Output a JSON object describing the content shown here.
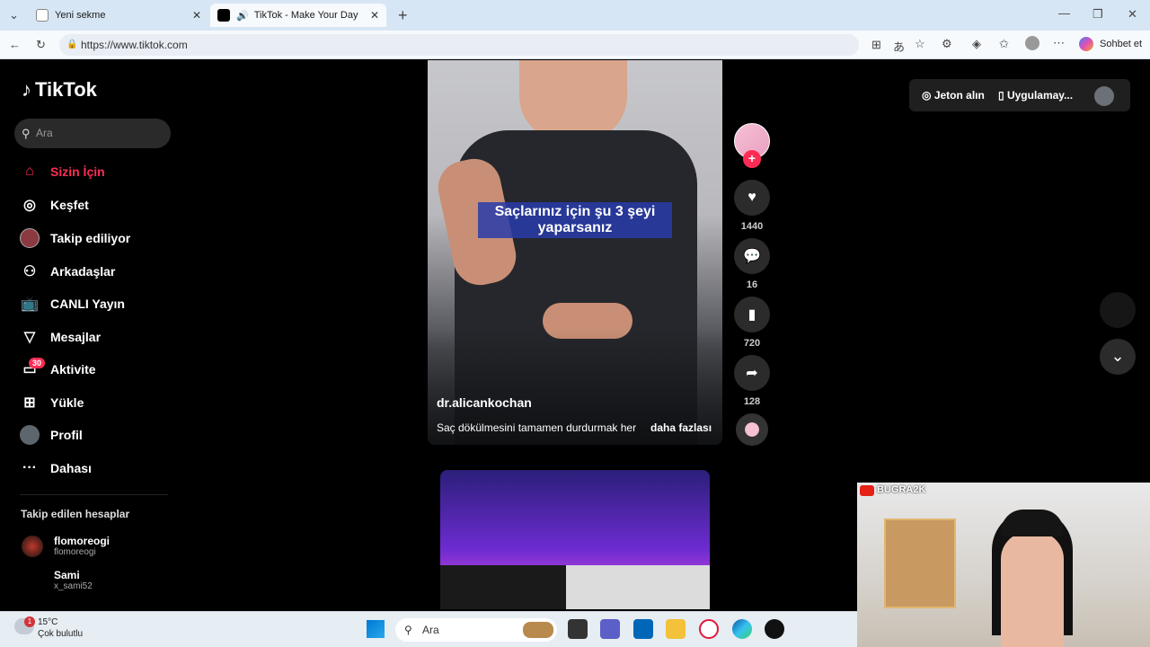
{
  "browser": {
    "tabs": [
      {
        "label": "Yeni sekme"
      },
      {
        "label": "TikTok - Make Your Day"
      }
    ],
    "url": "https://www.tiktok.com",
    "chat_label": "Sohbet et"
  },
  "sidebar": {
    "logo": "TikTok",
    "search_placeholder": "Ara",
    "nav": [
      {
        "label": "Sizin İçin",
        "icon": "home-icon"
      },
      {
        "label": "Keşfet",
        "icon": "compass-icon"
      },
      {
        "label": "Takip ediliyor",
        "icon": "avatar-icon"
      },
      {
        "label": "Arkadaşlar",
        "icon": "friends-icon"
      },
      {
        "label": "CANLI Yayın",
        "icon": "live-tv-icon"
      },
      {
        "label": "Mesajlar",
        "icon": "send-icon"
      },
      {
        "label": "Aktivite",
        "icon": "activity-icon"
      },
      {
        "label": "Yükle",
        "icon": "upload-icon"
      },
      {
        "label": "Profil",
        "icon": "profile-icon"
      },
      {
        "label": "Dahası",
        "icon": "more-icon"
      }
    ],
    "activity_badge": "30",
    "following_header": "Takip edilen hesaplar",
    "following": [
      {
        "name": "flomoreogi",
        "username": "flomoreogi"
      },
      {
        "name": "Sami",
        "username": "x_sami52"
      }
    ]
  },
  "video": {
    "caption": "Saçlarınız için şu 3 şeyi yaparsanız",
    "username": "dr.alicankochan",
    "description": "Saç dökülmesini tamamen durdurmak her",
    "more": "daha fazlası",
    "likes": "1440",
    "comments": "16",
    "saves": "720",
    "shares": "128"
  },
  "topbar": {
    "coins": "Jeton alın",
    "app": "Uygulamay..."
  },
  "taskbar": {
    "temperature": "15°C",
    "weather": "Çok bulutlu",
    "weather_badge": "1",
    "search": "Ara"
  },
  "webcam": {
    "channel": "BUGRA2K"
  },
  "colors": {
    "accent": "#fe2c55",
    "page_bg": "#000000",
    "caption_bg": "#2c3caa"
  }
}
